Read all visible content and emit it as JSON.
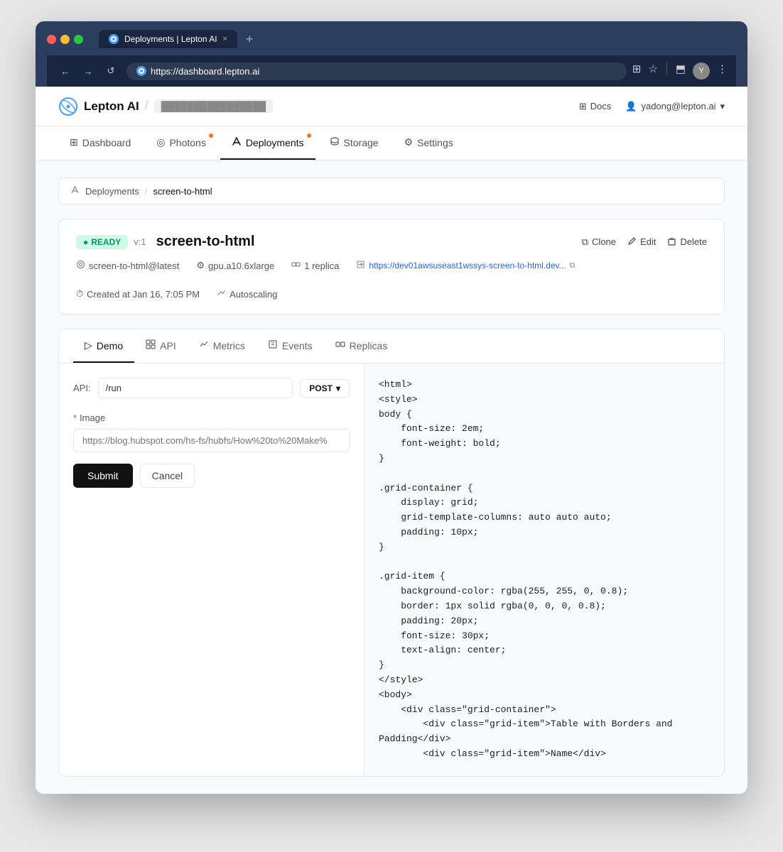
{
  "browser": {
    "tab_favicon": "⊙",
    "tab_title": "Deployments | Lepton AI",
    "tab_close": "×",
    "tab_new": "+",
    "url": "https://dashboard.lepton.ai",
    "nav_back": "←",
    "nav_forward": "→",
    "nav_reload": "↺",
    "toolbar_icons": [
      "⊞",
      "☆",
      "⬒",
      "⋮"
    ]
  },
  "app": {
    "logo_alt": "Lepton AI logo",
    "name": "Lepton AI",
    "workspace": "████████████████",
    "docs_label": "Docs",
    "user_email": "yadong@lepton.ai"
  },
  "nav": {
    "items": [
      {
        "id": "dashboard",
        "label": "Dashboard",
        "active": false,
        "dot": false,
        "icon": "⊞"
      },
      {
        "id": "photons",
        "label": "Photons",
        "active": false,
        "dot": true,
        "icon": "◎"
      },
      {
        "id": "deployments",
        "label": "Deployments",
        "active": true,
        "dot": true,
        "icon": "⤴"
      },
      {
        "id": "storage",
        "label": "Storage",
        "active": false,
        "dot": false,
        "icon": "⛰"
      },
      {
        "id": "settings",
        "label": "Settings",
        "active": false,
        "dot": false,
        "icon": "⚙"
      }
    ]
  },
  "breadcrumb": {
    "root": "Deployments",
    "current": "screen-to-html",
    "root_icon": "⤴"
  },
  "deployment": {
    "status": "READY",
    "status_dot": "●",
    "version": "v:1",
    "name": "screen-to-html",
    "clone_label": "Clone",
    "edit_label": "Edit",
    "delete_label": "Delete",
    "clone_icon": "⧉",
    "edit_icon": "✏",
    "delete_icon": "🗑",
    "image": "screen-to-html@latest",
    "gpu": "gpu.a10.6xlarge",
    "replicas": "1 replica",
    "created": "Created at Jan 16, 7:05 PM",
    "autoscaling": "Autoscaling",
    "url": "https://dev01awsuseast1wssys-screen-to-html.dev...",
    "copy_icon": "⧉",
    "image_icon": "⊙",
    "gpu_icon": "⚙",
    "replica_icon": "⧈",
    "clock_icon": "⏱",
    "scale_icon": "⤢"
  },
  "demo": {
    "tabs": [
      {
        "id": "demo",
        "label": "Demo",
        "active": true,
        "icon": "▷"
      },
      {
        "id": "api",
        "label": "API",
        "active": false,
        "icon": "⊞"
      },
      {
        "id": "metrics",
        "label": "Metrics",
        "active": false,
        "icon": "📈"
      },
      {
        "id": "events",
        "label": "Events",
        "active": false,
        "icon": "📋"
      },
      {
        "id": "replicas",
        "label": "Replicas",
        "active": false,
        "icon": "⧈"
      }
    ],
    "api_label": "API:",
    "api_path": "/run",
    "method": "POST",
    "method_chevron": "▾",
    "image_label": "Image",
    "image_placeholder": "https://blog.hubspot.com/hs-fs/hubfs/How%20to%20Make%",
    "submit_label": "Submit",
    "cancel_label": "Cancel",
    "code_output": [
      "<html>",
      "<style>",
      "body {",
      "    font-size: 2em;",
      "    font-weight: bold;",
      "}",
      "",
      ".grid-container {",
      "    display: grid;",
      "    grid-template-columns: auto auto auto;",
      "    padding: 10px;",
      "}",
      "",
      ".grid-item {",
      "    background-color: rgba(255, 255, 0, 0.8);",
      "    border: 1px solid rgba(0, 0, 0, 0.8);",
      "    padding: 20px;",
      "    font-size: 30px;",
      "    text-align: center;",
      "}",
      "</style>",
      "<body>",
      "    <div class=\"grid-container\">",
      "        <div class=\"grid-item\">Table with Borders and",
      "Padding</div>",
      "        <div class=\"grid-item\">Name</div>"
    ]
  }
}
